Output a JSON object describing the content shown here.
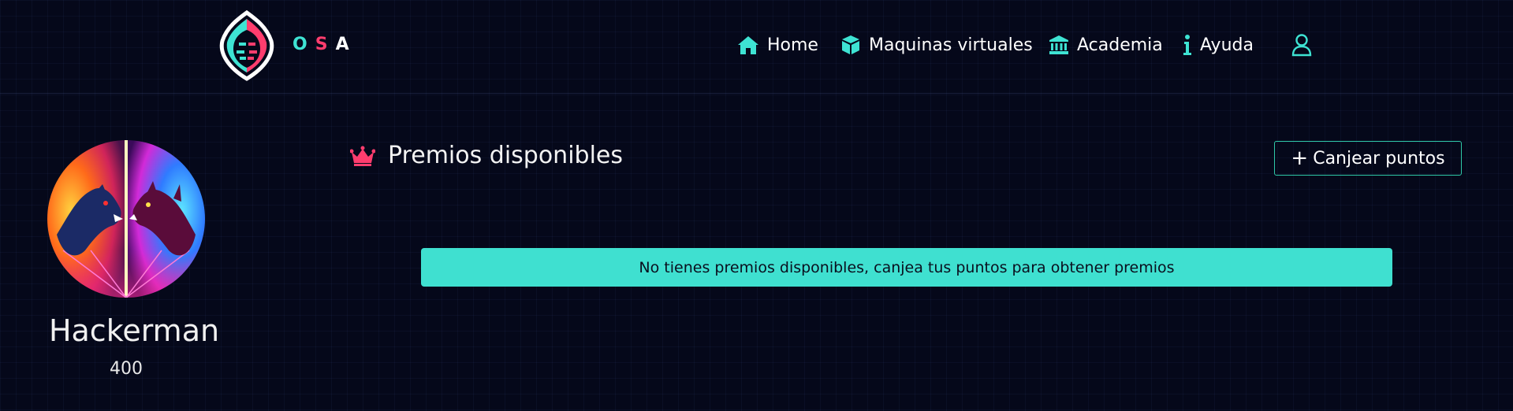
{
  "brand": {
    "letters": [
      "O",
      "S",
      "A"
    ],
    "colors": {
      "accent": "#3ee3d3",
      "secondary": "#ff3d6e",
      "text": "#ffffff"
    }
  },
  "nav": {
    "items": [
      {
        "label": "Home",
        "icon": "home-icon"
      },
      {
        "label": "Maquinas virtuales",
        "icon": "cube-icon"
      },
      {
        "label": "Academia",
        "icon": "bank-icon"
      },
      {
        "label": "Ayuda",
        "icon": "info-icon"
      }
    ],
    "user_icon": "user-icon"
  },
  "profile": {
    "name": "Hackerman",
    "points": "400"
  },
  "rewards": {
    "title": "Premios disponibles",
    "title_icon": "crown-icon",
    "redeem_button": "Canjear puntos",
    "empty_message": "No tienes premios disponibles, canjea tus puntos para obtener premios"
  }
}
